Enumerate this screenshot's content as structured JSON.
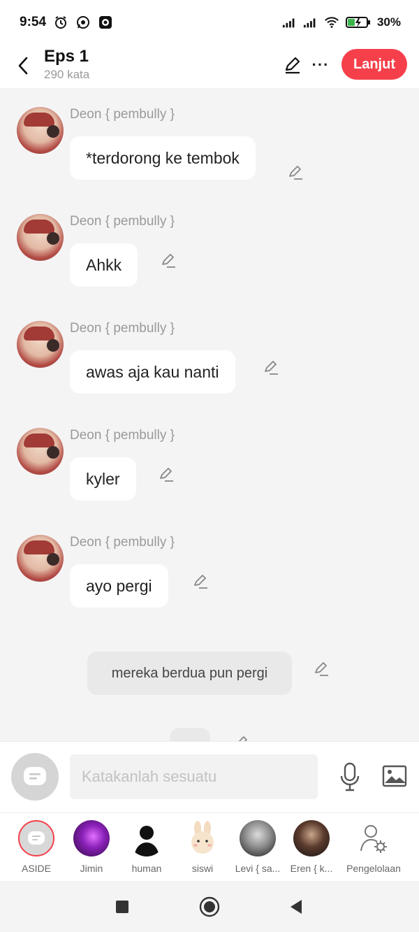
{
  "status_bar": {
    "time": "9:54",
    "battery": "30%",
    "icons": [
      "alarm-icon",
      "whatsapp-icon",
      "record-icon",
      "signal-icon",
      "signal-icon",
      "wifi-icon",
      "battery-icon"
    ]
  },
  "header": {
    "title": "Eps 1",
    "subtitle": "290 kata",
    "next_label": "Lanjut"
  },
  "messages": [
    {
      "sender": "Deon { pembully }",
      "text": "*terdorong ke tembok"
    },
    {
      "sender": "Deon { pembully }",
      "text": "Ahkk"
    },
    {
      "sender": "Deon { pembully }",
      "text": "awas aja kau nanti"
    },
    {
      "sender": "Deon { pembully }",
      "text": "kyler"
    },
    {
      "sender": "Deon { pembully }",
      "text": "ayo pergi"
    }
  ],
  "narration": {
    "text": "mereka berdua pun pergi"
  },
  "input": {
    "placeholder": "Katakanlah sesuatu",
    "value": ""
  },
  "characters": [
    {
      "label": "ASIDE",
      "active": true
    },
    {
      "label": "Jimin"
    },
    {
      "label": "human"
    },
    {
      "label": "siswi"
    },
    {
      "label": "Levi { sa..."
    },
    {
      "label": "Eren { k..."
    },
    {
      "label": "Pengelolaan"
    }
  ],
  "colors": {
    "accent": "#f5404b",
    "background": "#f4f4f4",
    "bubble": "#ffffff",
    "narration_bubble": "#e9e9e9",
    "muted_text": "#9a9a9a"
  }
}
